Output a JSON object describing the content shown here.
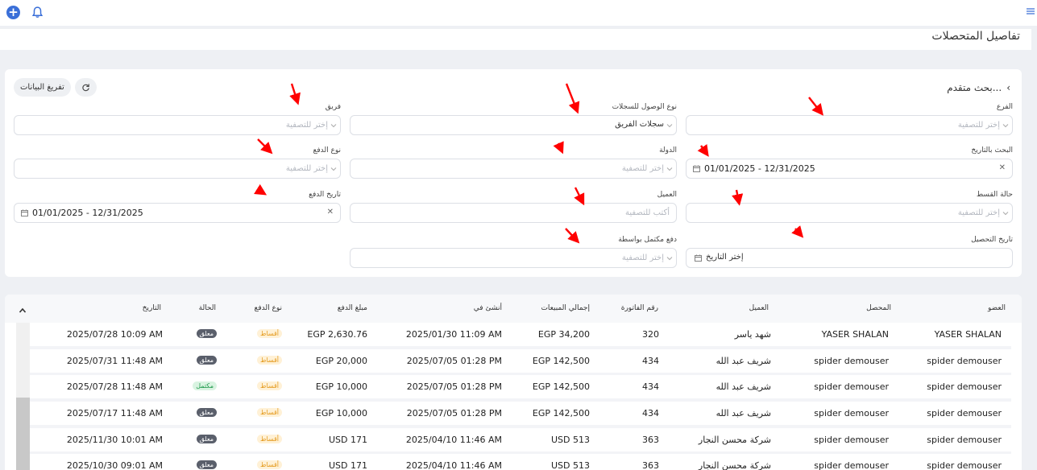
{
  "page": {
    "title": "تفاصيل المتحصلات"
  },
  "filters": {
    "advanced_search": "بحث متقدم...",
    "clear_label": "تفريغ البيانات",
    "branch": {
      "label": "الفرع",
      "placeholder": "إختر للتصفية"
    },
    "access_type": {
      "label": "نوع الوصول للسجلات",
      "value": "سجلات الفريق"
    },
    "team": {
      "label": "فريق",
      "placeholder": "إختر للتصفية"
    },
    "date_search": {
      "label": "البحث بالتاريخ",
      "value": "01/01/2025 - 12/31/2025"
    },
    "country": {
      "label": "الدولة",
      "placeholder": "إختر للتصفية"
    },
    "payment_type": {
      "label": "نوع الدفع",
      "placeholder": "إختر للتصفية"
    },
    "installment_status": {
      "label": "حالة القسط",
      "placeholder": "إختر للتصفية"
    },
    "client": {
      "label": "العميل",
      "placeholder": "أكتب للتصفية"
    },
    "payment_date": {
      "label": "تاريخ الدفع",
      "value": "01/01/2025 - 12/31/2025"
    },
    "collection_date": {
      "label": "تاريخ التحصيل",
      "placeholder": "إختر التاريخ"
    },
    "completed_by": {
      "label": "دفع مكتمل بواسطة",
      "placeholder": "إختر للتصفية"
    }
  },
  "table": {
    "headers": {
      "member": "العضو",
      "collector": "المحصل",
      "client": "العميل",
      "invoice": "رقم الفاتورة",
      "total_sales": "إجمالي المبيعات",
      "created_at": "أنشئ في",
      "amount": "مبلغ الدفع",
      "pay_type": "نوع الدفع",
      "status": "الحالة",
      "date": "التاريخ"
    },
    "rows": [
      {
        "member": "YASER SHALAN",
        "collector": "YASER SHALAN",
        "client": "شهد ياسر",
        "invoice": "320",
        "total": "EGP 34,200",
        "created": "2025/01/30 11:09 AM",
        "amount": "EGP 2,630.76",
        "type": "أقساط",
        "status": "معلق",
        "date": "2025/07/28 10:09 AM"
      },
      {
        "member": "spider demouser",
        "collector": "spider demouser",
        "client": "شريف عبد الله",
        "invoice": "434",
        "total": "EGP 142,500",
        "created": "2025/07/05 01:28 PM",
        "amount": "EGP 20,000",
        "type": "أقساط",
        "status": "معلق",
        "date": "2025/07/31 11:48 AM"
      },
      {
        "member": "spider demouser",
        "collector": "spider demouser",
        "client": "شريف عبد الله",
        "invoice": "434",
        "total": "EGP 142,500",
        "created": "2025/07/05 01:28 PM",
        "amount": "EGP 10,000",
        "type": "أقساط",
        "status": "مكتمل",
        "date": "2025/07/28 11:48 AM"
      },
      {
        "member": "spider demouser",
        "collector": "spider demouser",
        "client": "شريف عبد الله",
        "invoice": "434",
        "total": "EGP 142,500",
        "created": "2025/07/05 01:28 PM",
        "amount": "EGP 10,000",
        "type": "أقساط",
        "status": "معلق",
        "date": "2025/07/17 11:48 AM"
      },
      {
        "member": "spider demouser",
        "collector": "spider demouser",
        "client": "شركة محسن النجار",
        "invoice": "363",
        "total": "USD 513",
        "created": "2025/04/10 11:46 AM",
        "amount": "USD 171",
        "type": "أقساط",
        "status": "معلق",
        "date": "2025/11/30 10:01 AM"
      },
      {
        "member": "spider demouser",
        "collector": "spider demouser",
        "client": "شركة محسن النجار",
        "invoice": "363",
        "total": "USD 513",
        "created": "2025/04/10 11:46 AM",
        "amount": "USD 171",
        "type": "أقساط",
        "status": "معلق",
        "date": "2025/10/30 09:01 AM"
      }
    ]
  },
  "icons": {
    "plus": "plus-icon",
    "bell": "bell-icon",
    "menu": "menu-icon",
    "refresh": "refresh-icon",
    "chevron": "chevron-down-icon",
    "calendar": "calendar-icon",
    "clear": "close-icon",
    "back": "chevron-left-icon"
  },
  "colors": {
    "accent": "#3a6fd8",
    "annotation_arrow": "#ff0000",
    "installment_badge": "#e49a1e",
    "closed_badge": "#5a5f6b",
    "done_badge": "#1f9a4c"
  }
}
